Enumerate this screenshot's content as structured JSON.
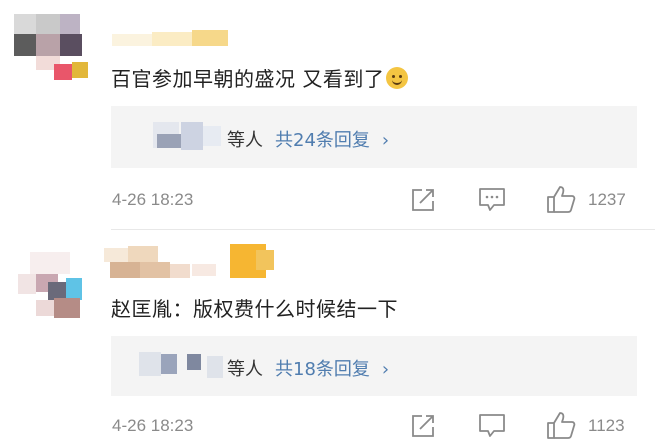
{
  "comments": [
    {
      "text": "百官参加早朝的盛况 又看到了",
      "emoji": "doge-emoji",
      "reply_who": "等人",
      "reply_link": "共24条回复",
      "time": "4-26 18:23",
      "likes": "1237"
    },
    {
      "text": "赵匡胤：版权费什么时候结一下",
      "reply_who": "等人",
      "reply_link": "共18条回复",
      "time": "4-26 18:23",
      "likes": "1123"
    }
  ],
  "icons": {
    "share": "share-icon",
    "comment": "comment-icon",
    "like": "thumbs-up-icon",
    "chevron": "chevron-right-icon"
  },
  "colors": {
    "link": "#507daf",
    "muted": "#8a8a8a",
    "reply_bg": "#f4f4f4"
  }
}
